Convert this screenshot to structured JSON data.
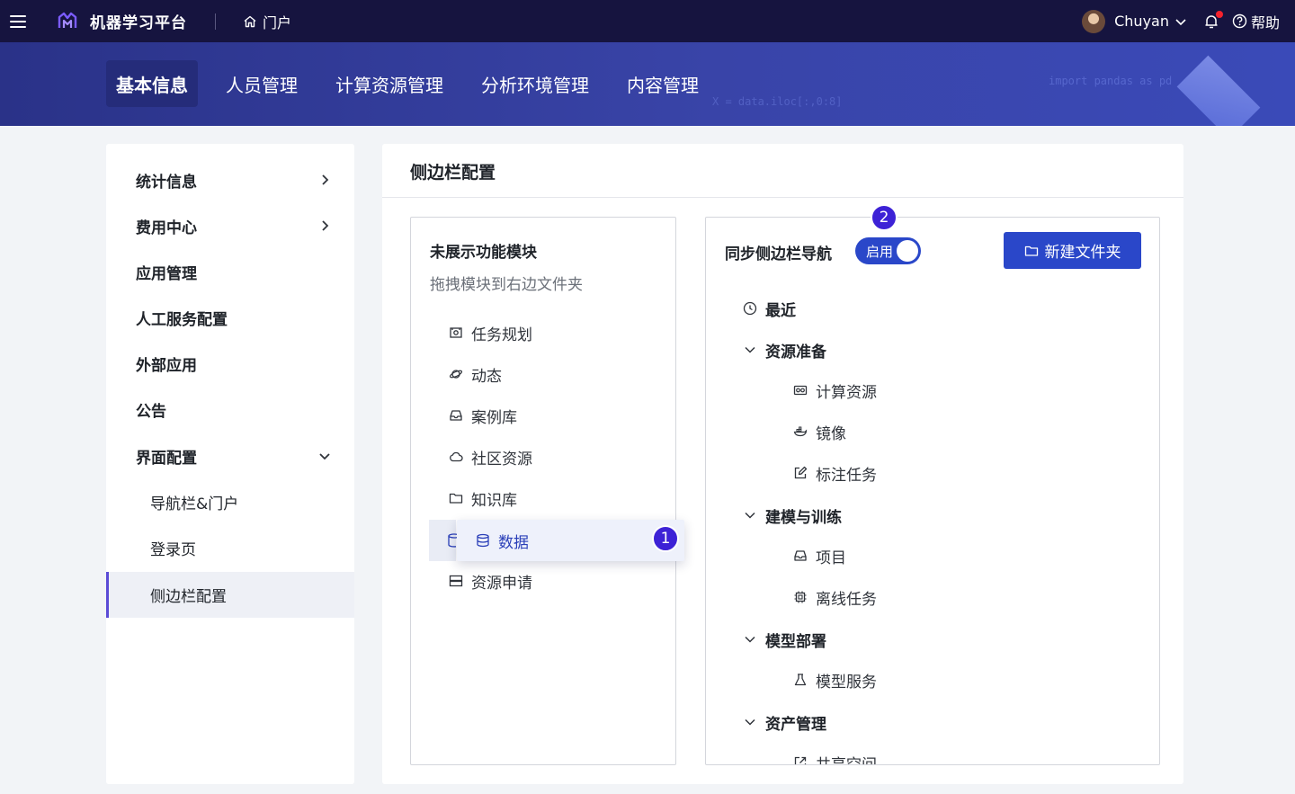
{
  "topbar": {
    "app_title": "机器学习平台",
    "portal_label": "门户",
    "user_name": "Chuyan",
    "help_label": "帮助"
  },
  "banner": {
    "code_line_1": "import pandas as pd",
    "code_line_2": "X = data.iloc[:,0:8]"
  },
  "tabs": [
    {
      "label": "基本信息",
      "active": true
    },
    {
      "label": "人员管理",
      "active": false
    },
    {
      "label": "计算资源管理",
      "active": false
    },
    {
      "label": "分析环境管理",
      "active": false
    },
    {
      "label": "内容管理",
      "active": false
    }
  ],
  "leftnav": {
    "items": [
      {
        "label": "统计信息"
      },
      {
        "label": "费用中心"
      },
      {
        "label": "应用管理"
      },
      {
        "label": "人工服务配置"
      },
      {
        "label": "外部应用"
      },
      {
        "label": "公告"
      },
      {
        "label": "界面配置"
      }
    ],
    "subitems": [
      {
        "label": "导航栏&门户"
      },
      {
        "label": "登录页"
      },
      {
        "label": "侧边栏配置",
        "active": true
      }
    ]
  },
  "main": {
    "title": "侧边栏配置",
    "left_box": {
      "title": "未展示功能模块",
      "subtitle": "拖拽模块到右边文件夹",
      "modules": [
        {
          "label": "任务规划",
          "icon": "task-plan-icon"
        },
        {
          "label": "动态",
          "icon": "planet-icon"
        },
        {
          "label": "案例库",
          "icon": "inbox-icon"
        },
        {
          "label": "社区资源",
          "icon": "cloud-icon"
        },
        {
          "label": "知识库",
          "icon": "folder-icon"
        },
        {
          "label": "资源申请",
          "icon": "server-icon"
        }
      ],
      "dragging": {
        "label": "数据",
        "icon": "database-icon",
        "step": "1"
      }
    },
    "right_box": {
      "title": "同步侧边栏导航",
      "switch_label": "启用",
      "switch_on": true,
      "step": "2",
      "new_folder_label": "新建文件夹",
      "tree": {
        "recent": "最近",
        "groups": [
          {
            "label": "资源准备",
            "children": [
              {
                "label": "计算资源",
                "icon": "gpu-icon"
              },
              {
                "label": "镜像",
                "icon": "docker-icon"
              },
              {
                "label": "标注任务",
                "icon": "edit-icon"
              }
            ]
          },
          {
            "label": "建模与训练",
            "children": [
              {
                "label": "项目",
                "icon": "project-icon"
              },
              {
                "label": "离线任务",
                "icon": "chip-icon"
              }
            ]
          },
          {
            "label": "模型部署",
            "children": [
              {
                "label": "模型服务",
                "icon": "flask-icon"
              }
            ]
          },
          {
            "label": "资产管理",
            "children": [
              {
                "label": "共享空间",
                "icon": "share-icon"
              }
            ]
          }
        ]
      }
    }
  },
  "colors": {
    "topbar": "#16143f",
    "banner": "#3140a0",
    "primary": "#2a47c9",
    "badge": "#3d22d6",
    "nav_active_border": "#5b4bd6"
  }
}
